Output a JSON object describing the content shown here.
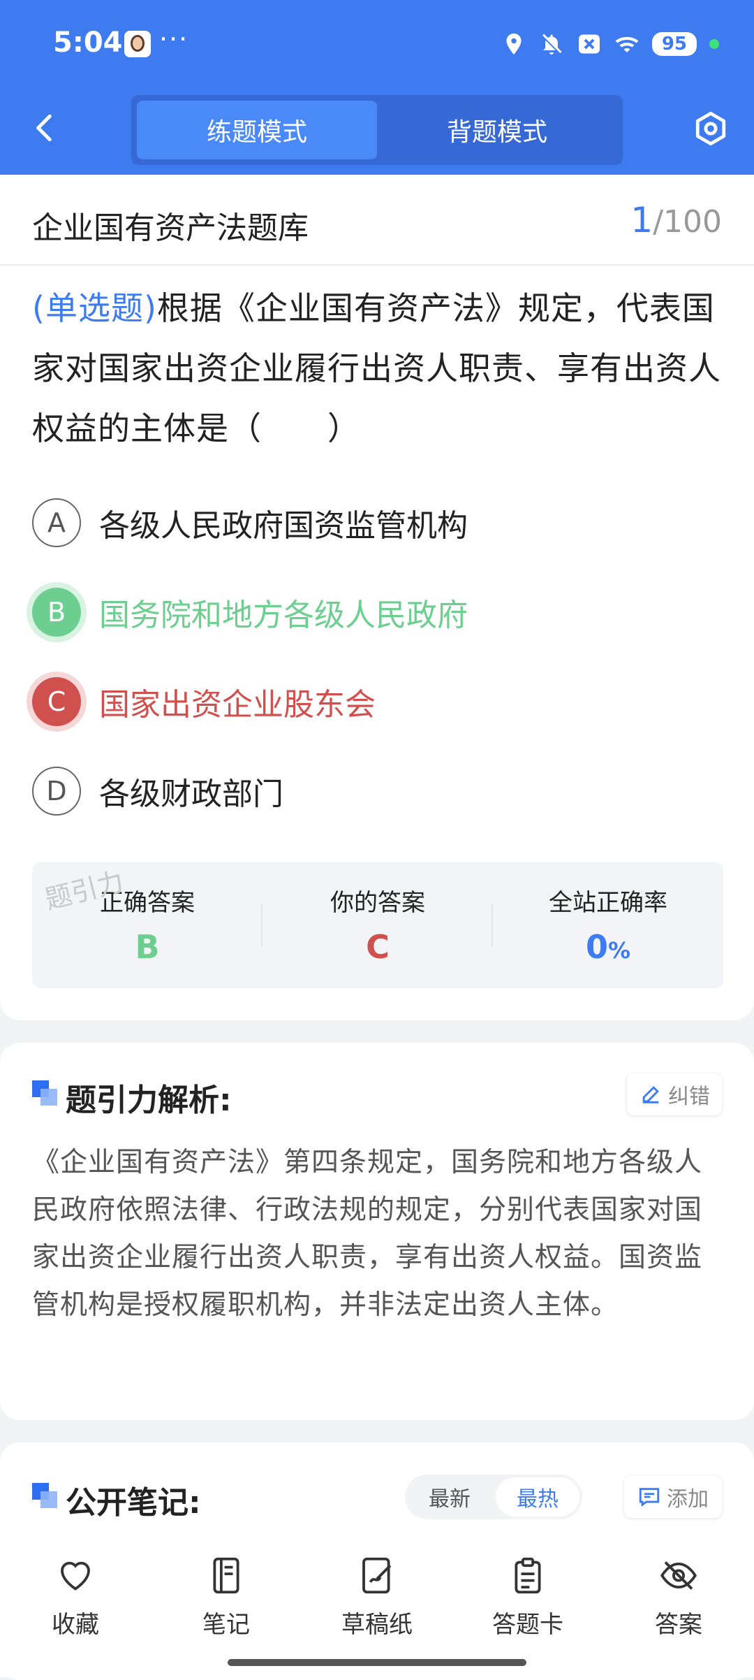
{
  "status_bar": {
    "time": "5:04",
    "dots": "···",
    "battery": "95"
  },
  "header": {
    "mode_practice": "练题模式",
    "mode_memorize": "背题模式"
  },
  "bank": {
    "title": "企业国有资产法题库",
    "current": "1",
    "total": "/100"
  },
  "question": {
    "type": "(单选题)",
    "text": "根据《企业国有资产法》规定，代表国家对国家出资企业履行出资人职责、享有出资人权益的主体是（　　）"
  },
  "options": [
    {
      "letter": "A",
      "text": "各级人民政府国资监管机构",
      "state": "normal"
    },
    {
      "letter": "B",
      "text": "国务院和地方各级人民政府",
      "state": "correct"
    },
    {
      "letter": "C",
      "text": "国家出资企业股东会",
      "state": "wrong"
    },
    {
      "letter": "D",
      "text": "各级财政部门",
      "state": "normal"
    }
  ],
  "answer_box": {
    "correct_label": "正确答案",
    "correct_value": "B",
    "yours_label": "你的答案",
    "yours_value": "C",
    "rate_label": "全站正确率",
    "rate_value": "0",
    "rate_unit": "%",
    "watermark": "题引力"
  },
  "analysis": {
    "title": "题引力解析:",
    "report_label": "纠错",
    "text": "《企业国有资产法》第四条规定，国务院和地方各级人民政府依照法律、行政法规的规定，分别代表国家对国家出资企业履行出资人职责，享有出资人权益。国资监管机构是授权履职机构，并非法定出资人主体。"
  },
  "notes": {
    "title": "公开笔记:",
    "sort_new": "最新",
    "sort_hot": "最热",
    "add_label": "添加"
  },
  "bottom_nav": {
    "favorite": "收藏",
    "notes": "笔记",
    "draft": "草稿纸",
    "answer_card": "答题卡",
    "answer": "答案"
  },
  "colors": {
    "primary": "#3f7bf0",
    "correct": "#6ccf8f",
    "wrong": "#d0504e"
  }
}
